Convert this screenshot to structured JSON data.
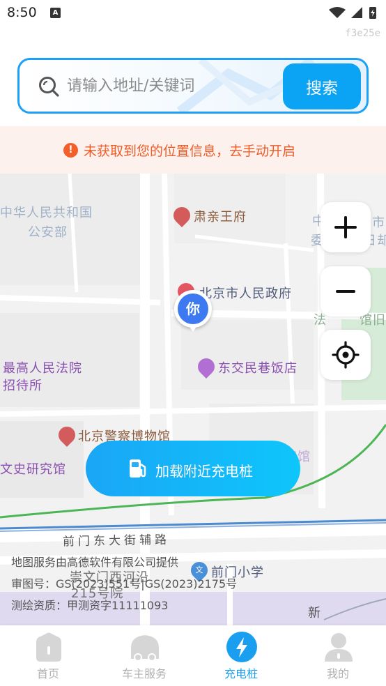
{
  "status_bar": {
    "time": "8:50",
    "notification_letter": "A"
  },
  "build_id": "f3e25e",
  "search": {
    "placeholder": "请输入地址/关键词",
    "value": "",
    "button_label": "搜索"
  },
  "warning": {
    "text": "未获取到您的位置信息，去手动开启",
    "icon_text": "!",
    "color": "#f05a25"
  },
  "map": {
    "labels": {
      "ministry": "中华人民共和国",
      "ministry_2": "公安部",
      "su_prince": "肃亲王府",
      "govt": "北京市人民政府",
      "court": "最高人民法院",
      "court_2": "招待所",
      "restaurant": "东交民巷饭店",
      "police_museum": "北京警察博物馆",
      "culture_inst": "文史研究馆",
      "hotel_faint": "宾馆",
      "road_qianmen": "前门东大街辅路",
      "chongwen": "崇文门西河沿",
      "yard": "215号院",
      "school": "前门小学",
      "right_top": "中",
      "right_top_2": "委",
      "right_top_3": "市",
      "right_top_4": "日却",
      "right_mid": "法",
      "right_mid_2": "馆旧",
      "new": "新"
    },
    "user_marker_text": "你",
    "poi_glyphs": {
      "school": "文"
    },
    "load_button_label": "加载附近充电桩",
    "attribution": [
      "地图服务由高德软件有限公司提供",
      "审图号：GS(2023)551号|GS(2023)2175号",
      "测绘资质：甲测资字11111093"
    ]
  },
  "controls": {
    "zoom_in": "zoom-in",
    "zoom_out": "zoom-out",
    "locate": "locate"
  },
  "bottom_nav": [
    {
      "label": "首页",
      "icon": "home-icon",
      "active": false
    },
    {
      "label": "车主服务",
      "icon": "car-icon",
      "active": false
    },
    {
      "label": "充电桩",
      "icon": "lightning-icon",
      "active": true
    },
    {
      "label": "我的",
      "icon": "person-icon",
      "active": false
    }
  ],
  "colors": {
    "accent": "#1a9ff0",
    "search_border": "#1ea0f6",
    "warning": "#f05a25",
    "marker": "#3d7af2"
  }
}
